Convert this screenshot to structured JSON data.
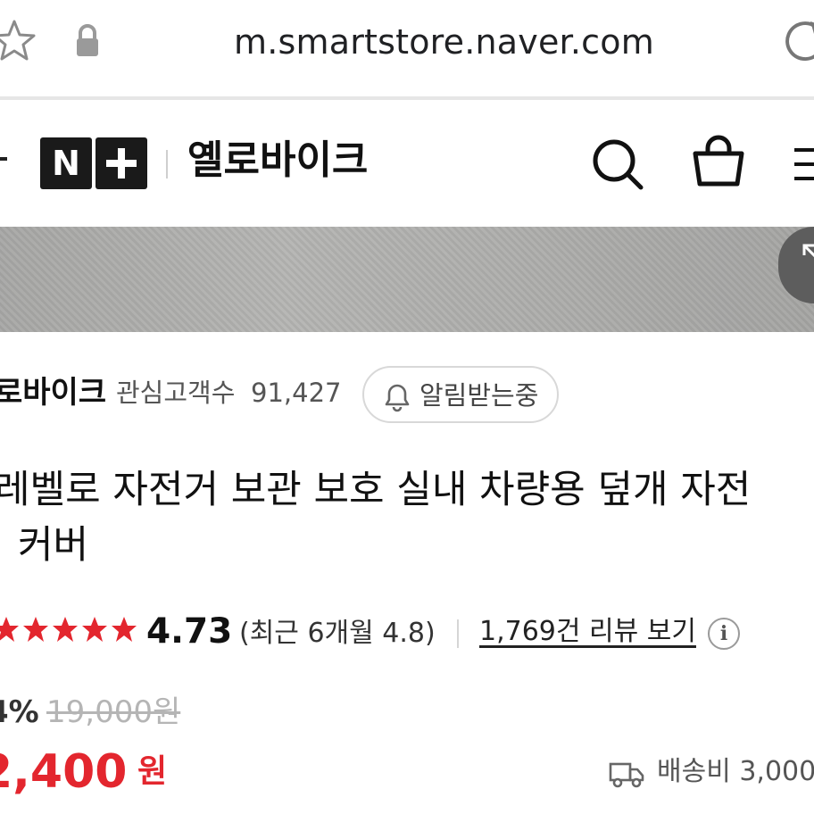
{
  "browser": {
    "url": "m.smartstore.naver.com",
    "icons": [
      "star-icon",
      "lock-icon",
      "reload-icon"
    ]
  },
  "header": {
    "logo_text": "N+",
    "store_name": "옐로바이크",
    "icons": [
      "search-icon",
      "shopping-bag-icon",
      "menu-icon"
    ]
  },
  "seller": {
    "name": "로바이크",
    "interest_label": "관심고객수",
    "interest_count": "91,427",
    "notify_label": "알림받는중"
  },
  "product": {
    "title_line1": "레벨로 자전거 보관 보호 실내 차량용 덮개 자전",
    "title_line2": "커버"
  },
  "rating": {
    "stars_out_of_5": 4.73,
    "score": "4.73",
    "recent": "(최근 6개월 4.8)",
    "review_link": "1,769건 리뷰 보기",
    "star_color": "#e3262e"
  },
  "price": {
    "discount_rate": "4%",
    "original": "19,000원",
    "sale": "2,400",
    "sale_unit": "원",
    "sale_color": "#e3262e"
  },
  "shipping": {
    "text": "배송비 3,000"
  }
}
